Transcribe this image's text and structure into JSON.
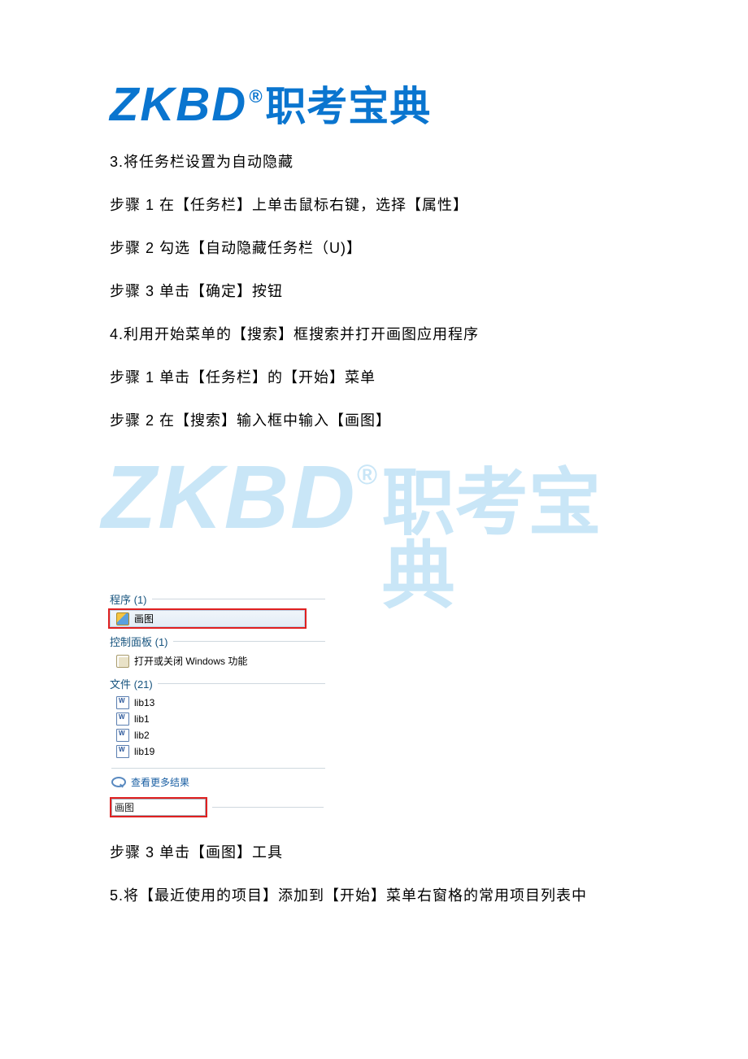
{
  "logo": {
    "latin": "ZKBD",
    "reg": "®",
    "cn": "职考宝典"
  },
  "body": {
    "q3_title": "3.将任务栏设置为自动隐藏",
    "q3_step1": "步骤 1 在【任务栏】上单击鼠标右键，选择【属性】",
    "q3_step2": "步骤 2 勾选【自动隐藏任务栏（U)】",
    "q3_step3": "步骤 3 单击【确定】按钮",
    "q4_title": "4.利用开始菜单的【搜索】框搜索并打开画图应用程序",
    "q4_step1": "步骤 1 单击【任务栏】的【开始】菜单",
    "q4_step2": "步骤 2 在【搜索】输入框中输入【画图】",
    "q4_step3": "步骤 3 单击【画图】工具",
    "q5_title": "5.将【最近使用的项目】添加到【开始】菜单右窗格的常用项目列表中"
  },
  "search_panel": {
    "programs_header": "程序 (1)",
    "program_item": "画图",
    "controlpanel_header": "控制面板 (1)",
    "controlpanel_item": "打开或关闭 Windows 功能",
    "files_header": "文件 (21)",
    "files": [
      "lib13",
      "lib1",
      "lib2",
      "lib19"
    ],
    "more_results": "查看更多结果",
    "search_value": "画图"
  }
}
